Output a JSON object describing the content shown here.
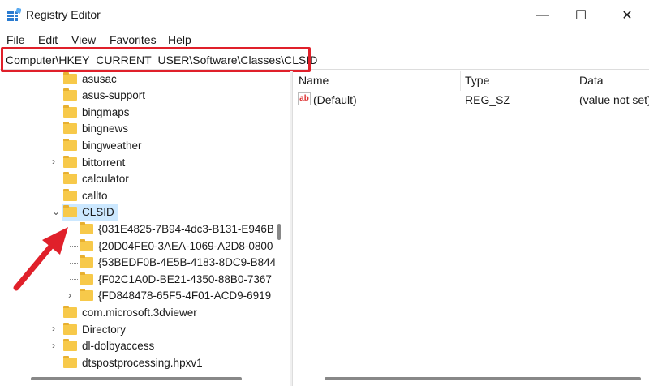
{
  "window": {
    "title": "Registry Editor",
    "minimize": "—",
    "maximize": "☐",
    "close": "✕"
  },
  "menu": [
    "File",
    "Edit",
    "View",
    "Favorites",
    "Help"
  ],
  "address": "Computer\\HKEY_CURRENT_USER\\Software\\Classes\\CLSID",
  "tree": [
    {
      "label": "asusac",
      "level": 0,
      "expander": ""
    },
    {
      "label": "asus-support",
      "level": 0,
      "expander": ""
    },
    {
      "label": "bingmaps",
      "level": 0,
      "expander": ""
    },
    {
      "label": "bingnews",
      "level": 0,
      "expander": ""
    },
    {
      "label": "bingweather",
      "level": 0,
      "expander": ""
    },
    {
      "label": "bittorrent",
      "level": 0,
      "expander": "›"
    },
    {
      "label": "calculator",
      "level": 0,
      "expander": ""
    },
    {
      "label": "callto",
      "level": 0,
      "expander": ""
    },
    {
      "label": "CLSID",
      "level": 0,
      "expander": "⌄",
      "selected": true
    },
    {
      "label": "{031E4825-7B94-4dc3-B131-E946B",
      "level": 1,
      "expander": ""
    },
    {
      "label": "{20D04FE0-3AEA-1069-A2D8-0800",
      "level": 1,
      "expander": ""
    },
    {
      "label": "{53BEDF0B-4E5B-4183-8DC9-B844",
      "level": 1,
      "expander": ""
    },
    {
      "label": "{F02C1A0D-BE21-4350-88B0-7367",
      "level": 1,
      "expander": ""
    },
    {
      "label": "{FD848478-65F5-4F01-ACD9-6919",
      "level": 1,
      "expander": "›"
    },
    {
      "label": "com.microsoft.3dviewer",
      "level": 0,
      "expander": ""
    },
    {
      "label": "Directory",
      "level": 0,
      "expander": "›"
    },
    {
      "label": "dl-dolbyaccess",
      "level": 0,
      "expander": "›"
    },
    {
      "label": "dtspostprocessing.hpxv1",
      "level": 0,
      "expander": ""
    }
  ],
  "values": {
    "headers": [
      "Name",
      "Type",
      "Data"
    ],
    "rows": [
      {
        "name": "(Default)",
        "type": "REG_SZ",
        "data": "(value not set)",
        "icon": "ab"
      }
    ]
  }
}
